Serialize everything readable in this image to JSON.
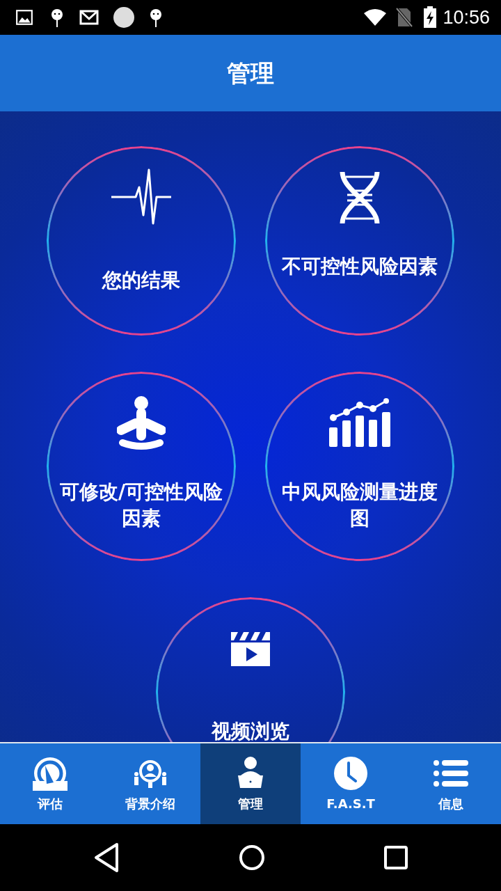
{
  "status_bar": {
    "time": "10:56"
  },
  "app_bar": {
    "title": "管理"
  },
  "tiles": [
    {
      "label": "您的结果"
    },
    {
      "label": "不可控性风险因素"
    },
    {
      "label": "可修改/可控性风险因素"
    },
    {
      "label": "中风风险测量进度图"
    },
    {
      "label": "视频浏览"
    }
  ],
  "bottom_nav": [
    {
      "label": "评估",
      "selected": false
    },
    {
      "label": "背景介绍",
      "selected": false
    },
    {
      "label": "管理",
      "selected": true
    },
    {
      "label": "F.A.S.T",
      "selected": false
    },
    {
      "label": "信息",
      "selected": false
    }
  ]
}
